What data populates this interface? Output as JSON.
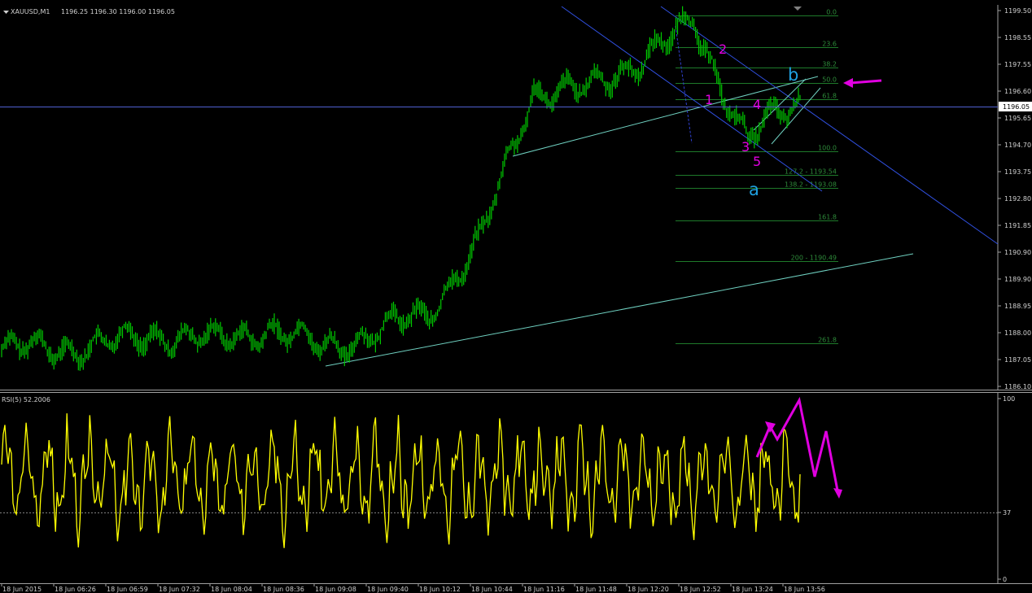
{
  "header": {
    "symbol": "XAUUSD,M1",
    "ohlc": "1196.25 1196.30 1196.00 1196.05"
  },
  "rsi_header": "RSI(5) 52.2006",
  "price_axis": [
    "1199.50",
    "1198.55",
    "1197.55",
    "1196.60",
    "1195.65",
    "1194.70",
    "1193.75",
    "1192.80",
    "1191.85",
    "1190.90",
    "1189.90",
    "1188.95",
    "1188.00",
    "1187.05",
    "1186.10"
  ],
  "current_price": "1196.05",
  "rsi_axis": [
    "100",
    "37",
    "0"
  ],
  "time_axis": [
    "18 Jun 2015",
    "18 Jun 06:26",
    "18 Jun 06:59",
    "18 Jun 07:32",
    "18 Jun 08:04",
    "18 Jun 08:36",
    "18 Jun 09:08",
    "18 Jun 09:40",
    "18 Jun 10:12",
    "18 Jun 10:44",
    "18 Jun 11:16",
    "18 Jun 11:48",
    "18 Jun 12:20",
    "18 Jun 12:52",
    "18 Jun 13:24",
    "18 Jun 13:56"
  ],
  "fib_levels": [
    {
      "label": "0.0",
      "price": 1199.23
    },
    {
      "label": "23.6",
      "price": 1198.09
    },
    {
      "label": "38.2",
      "price": 1197.38
    },
    {
      "label": "50.0",
      "price": 1196.81
    },
    {
      "label": "61.8",
      "price": 1196.24
    },
    {
      "label": "100.0",
      "price": 1194.39
    },
    {
      "label": "127.2 - 1193.54",
      "price": 1193.54
    },
    {
      "label": "138.2 - 1193.08",
      "price": 1193.08
    },
    {
      "label": "161.8",
      "price": 1191.93
    },
    {
      "label": "200 - 1190.49",
      "price": 1190.49
    },
    {
      "label": "261.8",
      "price": 1187.56
    }
  ],
  "wave_labels": [
    "1",
    "2",
    "3",
    "4",
    "5"
  ],
  "abc_labels": [
    "a",
    "b"
  ],
  "colors": {
    "candles": "#00d000",
    "rsi": "#ffff00",
    "annotation": "#e000e0",
    "trend": "#6fd0c0",
    "channel": "#3040d0"
  },
  "chart_data": {
    "type": "line",
    "instrument": "XAUUSD",
    "timeframe": "M1",
    "price_range": [
      1185.9,
      1199.6
    ],
    "rsi_range": [
      0,
      100
    ],
    "rsi_level": 37,
    "price_path": [
      {
        "t": "18 Jun 2015",
        "p": 1187.3
      },
      {
        "t": "18 Jun 06:26",
        "p": 1187.4
      },
      {
        "t": "18 Jun 06:59",
        "p": 1187.5
      },
      {
        "t": "18 Jun 07:32",
        "p": 1187.9
      },
      {
        "t": "18 Jun 08:04",
        "p": 1187.6
      },
      {
        "t": "18 Jun 08:36",
        "p": 1188.1
      },
      {
        "t": "18 Jun 09:08",
        "p": 1187.4
      },
      {
        "t": "18 Jun 09:40",
        "p": 1187.9
      },
      {
        "t": "18 Jun 10:12",
        "p": 1188.6
      },
      {
        "t": "18 Jun 10:44",
        "p": 1191.2
      },
      {
        "t": "18 Jun 11:16",
        "p": 1196.6
      },
      {
        "t": "18 Jun 11:48",
        "p": 1196.5
      },
      {
        "t": "18 Jun 12:20",
        "p": 1197.7
      },
      {
        "t": "18 Jun 12:52",
        "p": 1198.9
      },
      {
        "t": "18 Jun 13:24",
        "p": 1194.9
      },
      {
        "t": "18 Jun 13:56",
        "p": 1196.05
      }
    ]
  }
}
